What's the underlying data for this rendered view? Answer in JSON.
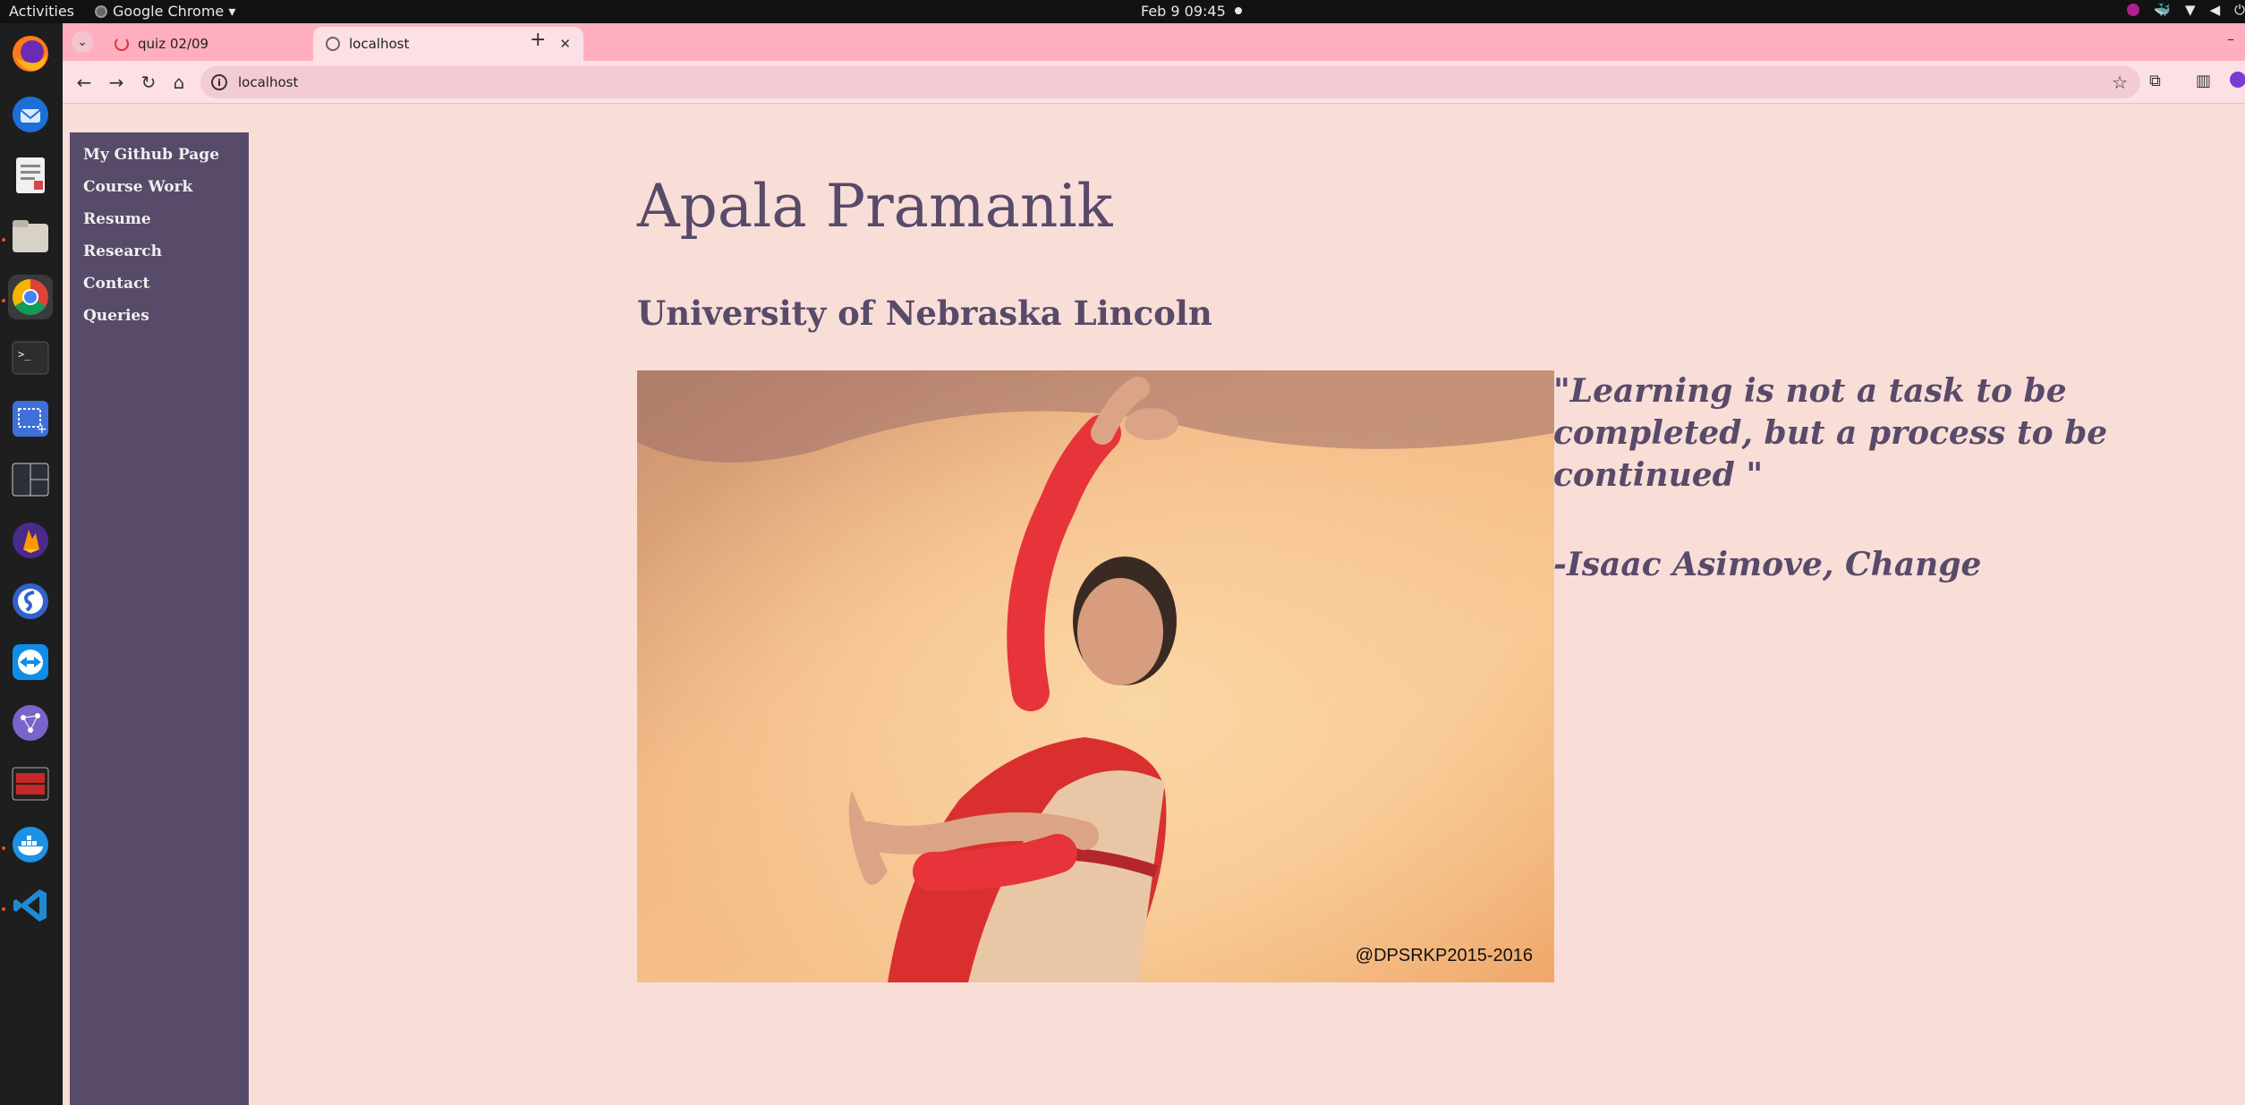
{
  "topbar": {
    "activities": "Activities",
    "app_menu": "Google Chrome ▾",
    "clock": "Feb 9  09:45"
  },
  "dock": {
    "apps": [
      "firefox-icon",
      "thunderbird-icon",
      "text-editor-icon",
      "files-icon",
      "chrome-icon",
      "terminal-icon",
      "screenshot-icon",
      "terminal-split-icon",
      "firebase-icon",
      "simplenote-icon",
      "teamviewer-icon",
      "network-icon",
      "app-icon",
      "docker-icon",
      "vscode-icon"
    ]
  },
  "browser": {
    "tabs": [
      {
        "label": "quiz 02/09",
        "active": false
      },
      {
        "label": "localhost",
        "active": true
      }
    ],
    "url": "localhost"
  },
  "page": {
    "nav": [
      "My Github Page",
      "Course Work",
      "Resume",
      "Research",
      "Contact",
      "Queries"
    ],
    "title": "Apala Pramanik",
    "subtitle": "University of Nebraska Lincoln",
    "photo_watermark": "@DPSRKP2015-2016",
    "quote": "\"Learning is not a task to be completed, but a process to be continued \"",
    "quote_author": "-Isaac Asimove, Change"
  },
  "colors": {
    "page_bg": "#f9ded8",
    "accent": "#584a69",
    "tabstrip": "#ffaebf"
  }
}
